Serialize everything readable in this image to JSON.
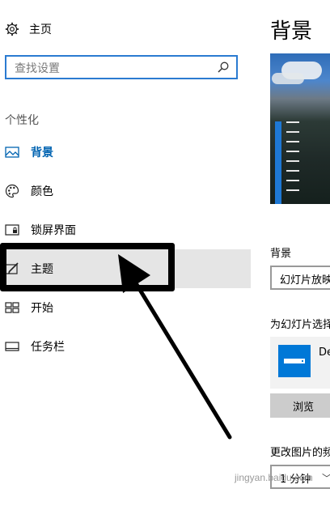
{
  "nav": {
    "home_label": "主页",
    "search_placeholder": "查找设置",
    "group_title": "个性化",
    "items": [
      {
        "label": "背景",
        "icon": "picture-icon",
        "state": "selected"
      },
      {
        "label": "颜色",
        "icon": "palette-icon",
        "state": "normal"
      },
      {
        "label": "锁屏界面",
        "icon": "lock-screen-icon",
        "state": "normal"
      },
      {
        "label": "主题",
        "icon": "theme-brush-icon",
        "state": "hover"
      },
      {
        "label": "开始",
        "icon": "start-grid-icon",
        "state": "normal"
      },
      {
        "label": "任务栏",
        "icon": "taskbar-icon",
        "state": "normal"
      }
    ]
  },
  "content": {
    "title": "背景",
    "background_label": "背景",
    "background_value": "幻灯片放映",
    "album_label": "为幻灯片选择相册",
    "album_name": "Desktop",
    "browse_label": "浏览",
    "interval_label": "更改图片的频率",
    "interval_value": "1 分钟"
  },
  "watermark": "jingyan.baidu.com",
  "colors": {
    "accent": "#0078d7",
    "active_text": "#0063b1",
    "hover_bg": "#e5e5e5",
    "annotation": "#000000"
  }
}
